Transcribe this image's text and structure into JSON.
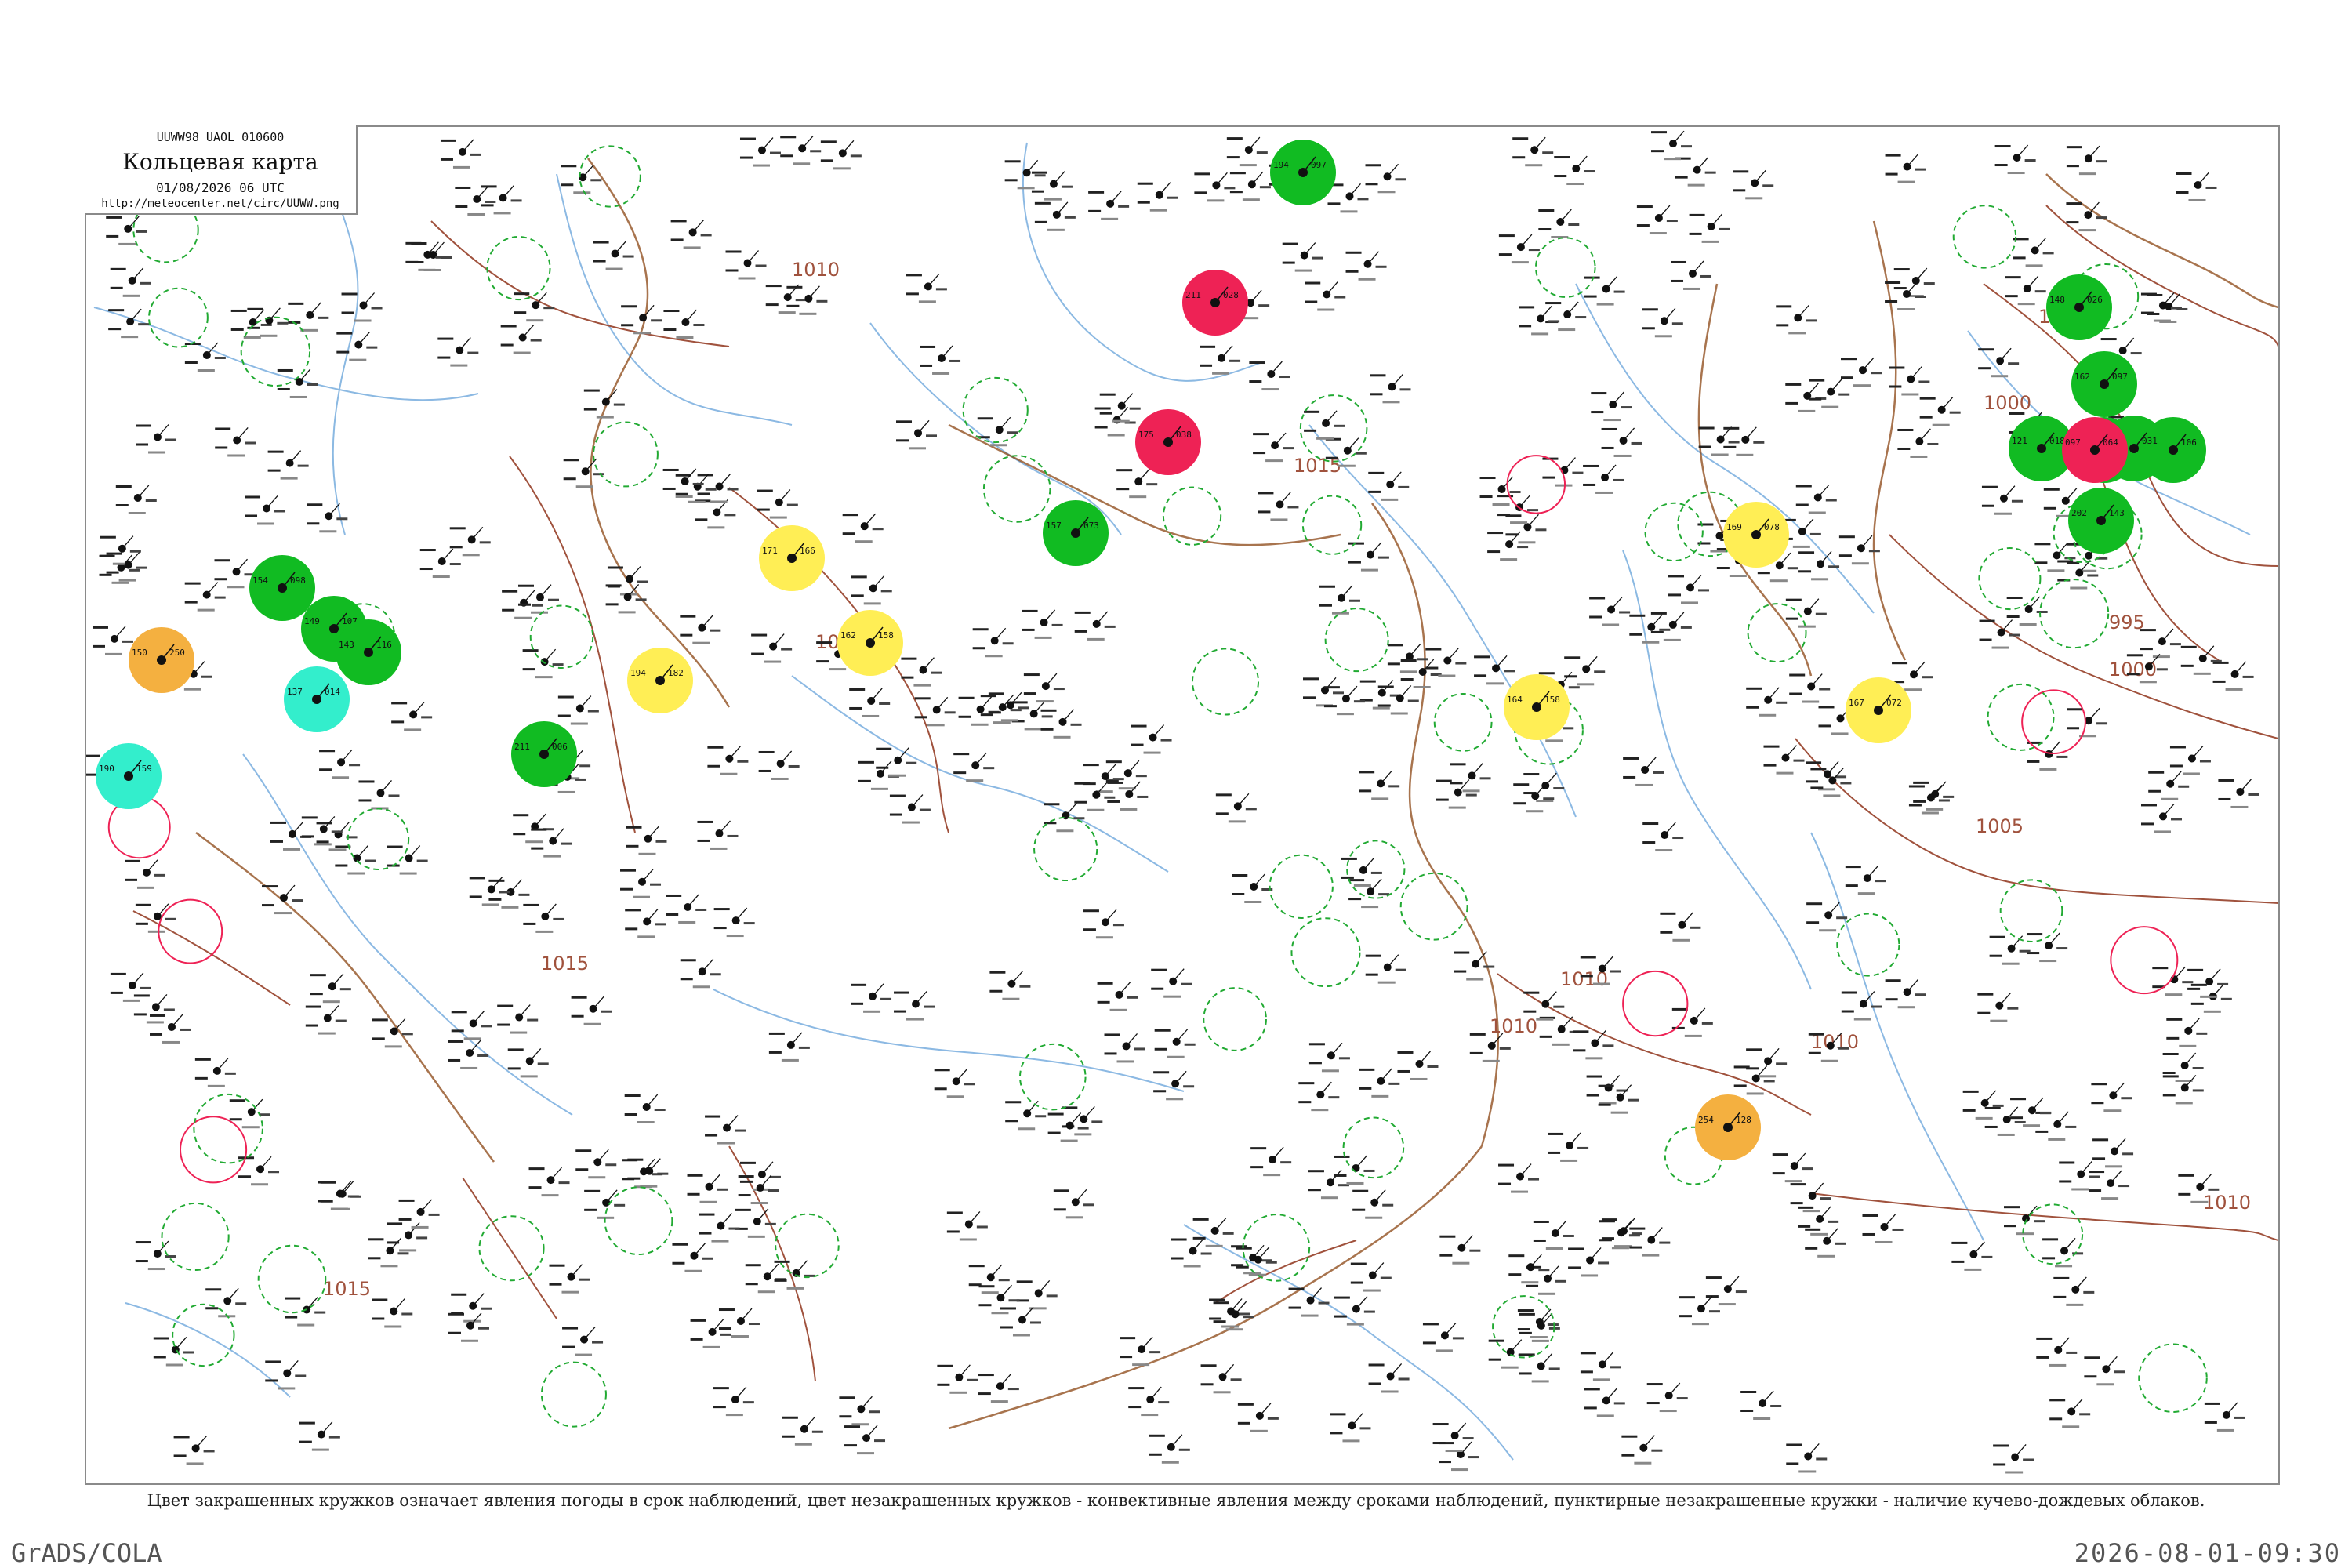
{
  "header": {
    "code": "UUWW98  UAOL  010600",
    "title": "Кольцевая карта",
    "datetime": "01/08/2026 06 UTC",
    "url": "http://meteocenter.net/circ/UUWW.png"
  },
  "caption": "Цвет закрашенных кружков означает явления погоды в срок наблюдений, цвет незакрашенных кружков - конвективные явления между сроками наблюдений, пунктирные незакрашенные кружки - наличие кучево-дождевых облаков.",
  "footer": {
    "software": "GrADS/COLA",
    "timestamp": "2026-08-01-09:30"
  },
  "colors": {
    "frame": "#8a8a8a",
    "river": "#6fa8dc",
    "border": "#8b4513",
    "isobar": "#a0523d",
    "rain": "#11bb22",
    "thunder": "#ee2255",
    "fog": "#ffee55",
    "haze": "#f4b040",
    "drizzle": "#33eecc",
    "convective_ring": "#22aa33"
  },
  "isobars": [
    {
      "value": "1005"
    },
    {
      "value": "1000"
    },
    {
      "value": "995"
    },
    {
      "value": "1000"
    },
    {
      "value": "1005"
    },
    {
      "value": "1010"
    },
    {
      "value": "1015"
    },
    {
      "value": "1010"
    },
    {
      "value": "1015"
    },
    {
      "value": "1010"
    },
    {
      "value": "1015"
    },
    {
      "value": "1015"
    },
    {
      "value": "1010"
    },
    {
      "value": "1010"
    }
  ],
  "stations": [
    {
      "temp": "194",
      "pres": "097",
      "phenomenon": "rain"
    },
    {
      "temp": "148",
      "pres": "026",
      "phenomenon": "rain"
    },
    {
      "temp": "162",
      "pres": "097",
      "phenomenon": "rain"
    },
    {
      "temp": "131",
      "pres": "007",
      "phenomenon": "rain"
    },
    {
      "temp": "121",
      "pres": "018",
      "phenomenon": "rain"
    },
    {
      "temp": "190",
      "pres": "159",
      "phenomenon": "drizzle"
    },
    {
      "temp": "137",
      "pres": "014",
      "phenomenon": "drizzle"
    },
    {
      "temp": "150",
      "pres": "250",
      "phenomenon": "haze"
    },
    {
      "temp": "171",
      "pres": "166",
      "phenomenon": "fog"
    },
    {
      "temp": "194",
      "pres": "182",
      "phenomenon": "fog"
    },
    {
      "temp": "162",
      "pres": "158",
      "phenomenon": "fog"
    },
    {
      "temp": "164",
      "pres": "158",
      "phenomenon": "fog"
    },
    {
      "temp": "169",
      "pres": "078",
      "phenomenon": "fog"
    },
    {
      "temp": "167",
      "pres": "072",
      "phenomenon": "fog"
    },
    {
      "temp": "254",
      "pres": "128",
      "phenomenon": "haze"
    },
    {
      "temp": "211",
      "pres": "028",
      "phenomenon": "thunder"
    },
    {
      "temp": "175",
      "pres": "038",
      "phenomenon": "thunder"
    },
    {
      "temp": "202",
      "pres": "143",
      "phenomenon": "rain"
    },
    {
      "temp": "164",
      "pres": "106",
      "phenomenon": "rain"
    },
    {
      "temp": "097",
      "pres": "031",
      "phenomenon": "rain"
    },
    {
      "temp": "097",
      "pres": "064",
      "phenomenon": "thunder"
    },
    {
      "temp": "154",
      "pres": "098",
      "phenomenon": "rain"
    },
    {
      "temp": "149",
      "pres": "107",
      "phenomenon": "rain"
    },
    {
      "temp": "143",
      "pres": "116",
      "phenomenon": "rain"
    },
    {
      "temp": "211",
      "pres": "006",
      "phenomenon": "rain"
    },
    {
      "temp": "157",
      "pres": "073",
      "phenomenon": "rain"
    }
  ]
}
